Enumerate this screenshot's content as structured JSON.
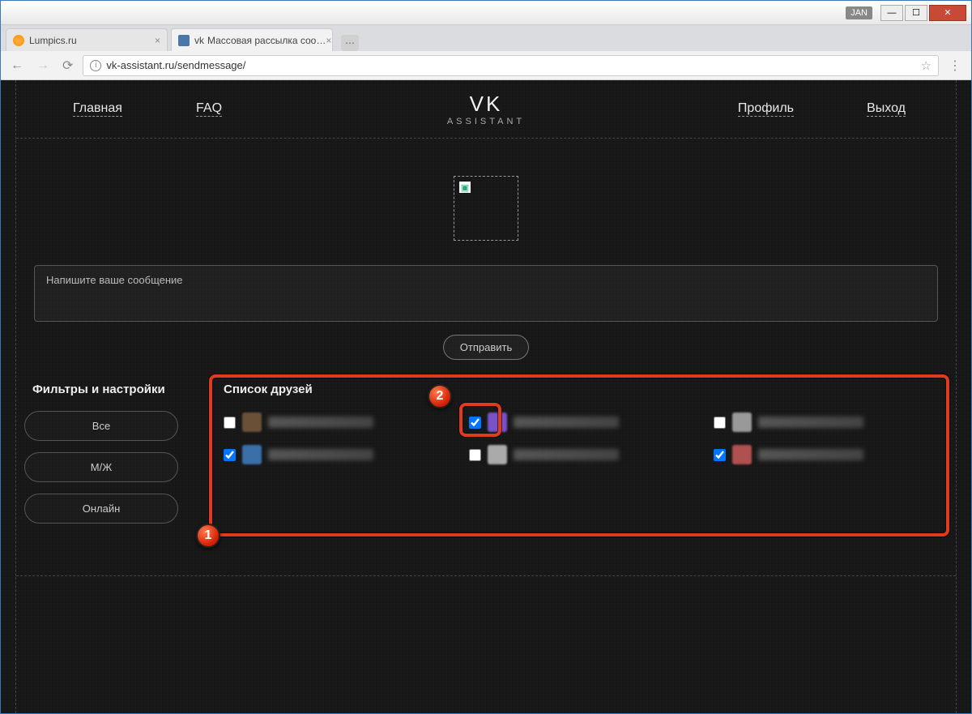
{
  "window": {
    "lang_badge": "JAN"
  },
  "tabs": [
    {
      "title": "Lumpics.ru",
      "active": false
    },
    {
      "title": "Массовая рассылка соо…",
      "prefix": "vk",
      "active": true
    }
  ],
  "address_bar": {
    "url": "vk-assistant.ru/sendmessage/"
  },
  "nav": {
    "home": "Главная",
    "faq": "FAQ",
    "profile": "Профиль",
    "logout": "Выход",
    "brand_title": "VK",
    "brand_sub": "ASSISTANT"
  },
  "message": {
    "placeholder": "Напишите ваше сообщение",
    "send": "Отправить"
  },
  "filters": {
    "heading": "Фильтры и настройки",
    "all": "Все",
    "gender": "М/Ж",
    "online": "Онлайн"
  },
  "friends": {
    "heading": "Список друзей",
    "items": [
      {
        "checked": false,
        "avatar_color": "#6b5038"
      },
      {
        "checked": true,
        "avatar_color": "#7a52c7"
      },
      {
        "checked": false,
        "avatar_color": "#999"
      },
      {
        "checked": true,
        "avatar_color": "#3a6fa8"
      },
      {
        "checked": false,
        "avatar_color": "#aaa"
      },
      {
        "checked": true,
        "avatar_color": "#b05050"
      }
    ]
  },
  "callouts": {
    "one": "1",
    "two": "2"
  }
}
